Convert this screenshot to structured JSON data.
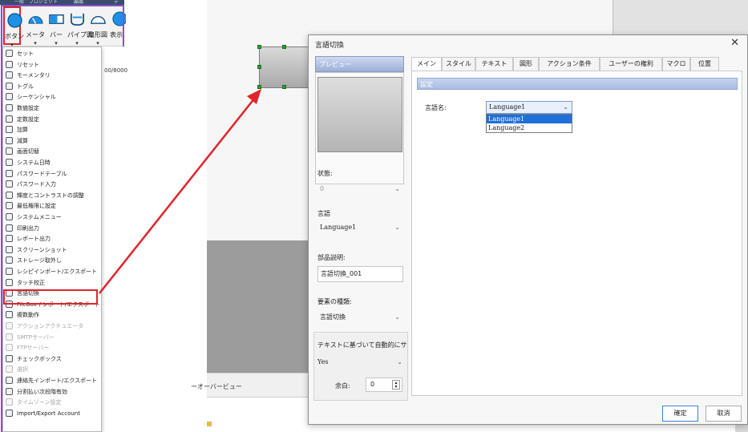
{
  "ribbon": {
    "tabs": [
      "一般",
      "プロジェクト",
      "部品",
      "デ"
    ],
    "buttons": [
      {
        "label": "ボタン",
        "icon": "button-icon"
      },
      {
        "label": "メータ",
        "icon": "meter-icon"
      },
      {
        "label": "バー",
        "icon": "bar-icon"
      },
      {
        "label": "パイプ図",
        "icon": "pipe-icon"
      },
      {
        "label": "扇形図",
        "icon": "fan-icon"
      },
      {
        "label": "表示",
        "icon": "display-icon"
      }
    ]
  },
  "menu": {
    "items": [
      {
        "label": "セット",
        "disabled": false
      },
      {
        "label": "リセット",
        "disabled": false
      },
      {
        "label": "モーメンタリ",
        "disabled": false
      },
      {
        "label": "トグル",
        "disabled": false
      },
      {
        "label": "シーケンシャル",
        "disabled": false
      },
      {
        "label": "数値設定",
        "disabled": false
      },
      {
        "label": "定数設定",
        "disabled": false
      },
      {
        "label": "加算",
        "disabled": false
      },
      {
        "label": "減算",
        "disabled": false
      },
      {
        "label": "画面切替",
        "disabled": false
      },
      {
        "label": "システム日時",
        "disabled": false
      },
      {
        "label": "パスワードテーブル",
        "disabled": false
      },
      {
        "label": "パスワード入力",
        "disabled": false
      },
      {
        "label": "輝度とコントラストの調整",
        "disabled": false
      },
      {
        "label": "最低権限に設定",
        "disabled": false
      },
      {
        "label": "システムメニュー",
        "disabled": false
      },
      {
        "label": "印刷出力",
        "disabled": false
      },
      {
        "label": "レポート出力",
        "disabled": false
      },
      {
        "label": "スクリーンショット",
        "disabled": false
      },
      {
        "label": "ストレージ取外し",
        "disabled": false
      },
      {
        "label": "レシピインポート/エクスポート",
        "disabled": false
      },
      {
        "label": "タッチ校正",
        "disabled": false
      },
      {
        "label": "言語切換",
        "disabled": false
      },
      {
        "label": "FileBoxインポート/エクスポート",
        "disabled": false
      },
      {
        "label": "複数動作",
        "disabled": false
      },
      {
        "label": "アクションアクチュエータ",
        "disabled": true
      },
      {
        "label": "SMTPサーバー",
        "disabled": true
      },
      {
        "label": "FTPサーバー",
        "disabled": true
      },
      {
        "label": "チェックボックス",
        "disabled": false
      },
      {
        "label": "選択",
        "disabled": true
      },
      {
        "label": "連絡先インポート/エクスポート",
        "disabled": false
      },
      {
        "label": "分割払い次段階有効",
        "disabled": false
      },
      {
        "label": "タイムゾーン設定",
        "disabled": true
      },
      {
        "label": "Import/Export Account",
        "disabled": false
      }
    ]
  },
  "canvas": {
    "counter_text": "00/8000"
  },
  "editor": {
    "overview_label": "ーオーバービュー"
  },
  "dialog": {
    "title": "言語切換",
    "close_glyph": "✕",
    "preview_label": "プレビュー",
    "state_label": "状態:",
    "state_value": "0",
    "language_label": "言語",
    "language_value": "Language1",
    "part_desc_label": "部品説明:",
    "part_desc_value": "言語切換_001",
    "element_type_label": "要素の種類:",
    "element_type_value": "言語切換",
    "auto_text_label": "テキストに基づいて自動的にサ",
    "auto_text_value": "Yes",
    "margin_label": "余白:",
    "margin_value": "0",
    "tabs": [
      "メイン",
      "スタイル",
      "テキスト",
      "図形",
      "アクション条件",
      "ユーザーの権利",
      "マクロ",
      "位置"
    ],
    "active_tab": "メイン",
    "settings_header": "設定",
    "lang_name_label": "言語名:",
    "lang_selected": "Language1",
    "lang_options": [
      "Language1",
      "Language2"
    ],
    "ok_label": "確定",
    "cancel_label": "取消"
  },
  "colors": {
    "highlight_red": "#e0242a",
    "menu_border_purple": "#8a4fd1",
    "selection_blue": "#1e6fd9"
  }
}
